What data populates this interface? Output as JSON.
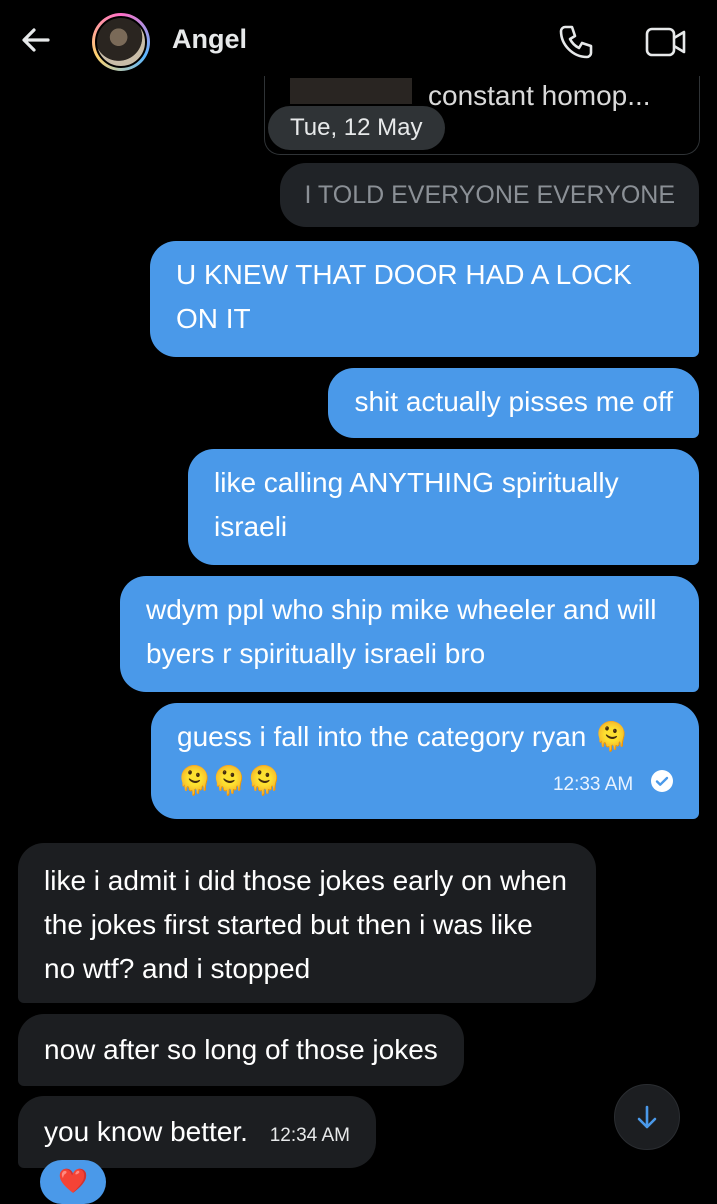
{
  "header": {
    "contact_name": "Angel",
    "icons": [
      "back-arrow-icon",
      "phone-icon",
      "video-icon"
    ]
  },
  "shared_card": {
    "preview_text": "constant homop..."
  },
  "date_separator": "Tue, 12 May",
  "messages": [
    {
      "direction": "sent",
      "text": "I TOLD EVERYONE EVERYONE",
      "style": "muted"
    },
    {
      "direction": "sent",
      "text": "U KNEW THAT DOOR HAD A LOCK ON IT"
    },
    {
      "direction": "sent",
      "text": "shit actually pisses me off"
    },
    {
      "direction": "sent",
      "text": "like calling ANYTHING spiritually israeli"
    },
    {
      "direction": "sent",
      "text": "wdym ppl who ship mike wheeler and will byers r spiritually israeli bro"
    },
    {
      "direction": "sent",
      "text": "guess i fall into the category ryan",
      "emojis": "🫠🫠🫠🫠",
      "time": "12:33 AM",
      "status": "read"
    },
    {
      "direction": "received",
      "text": "like i admit i did those jokes early on when the jokes first started but then i was like no wtf? and i stopped"
    },
    {
      "direction": "received",
      "text": "now after so long of those jokes"
    },
    {
      "direction": "received",
      "text": "you know better.",
      "time": "12:34 AM"
    }
  ],
  "reaction": {
    "emoji": "❤️"
  },
  "colors": {
    "sent_bubble": "#4a99e9",
    "received_bubble": "#1c1e21",
    "background": "#000000"
  }
}
